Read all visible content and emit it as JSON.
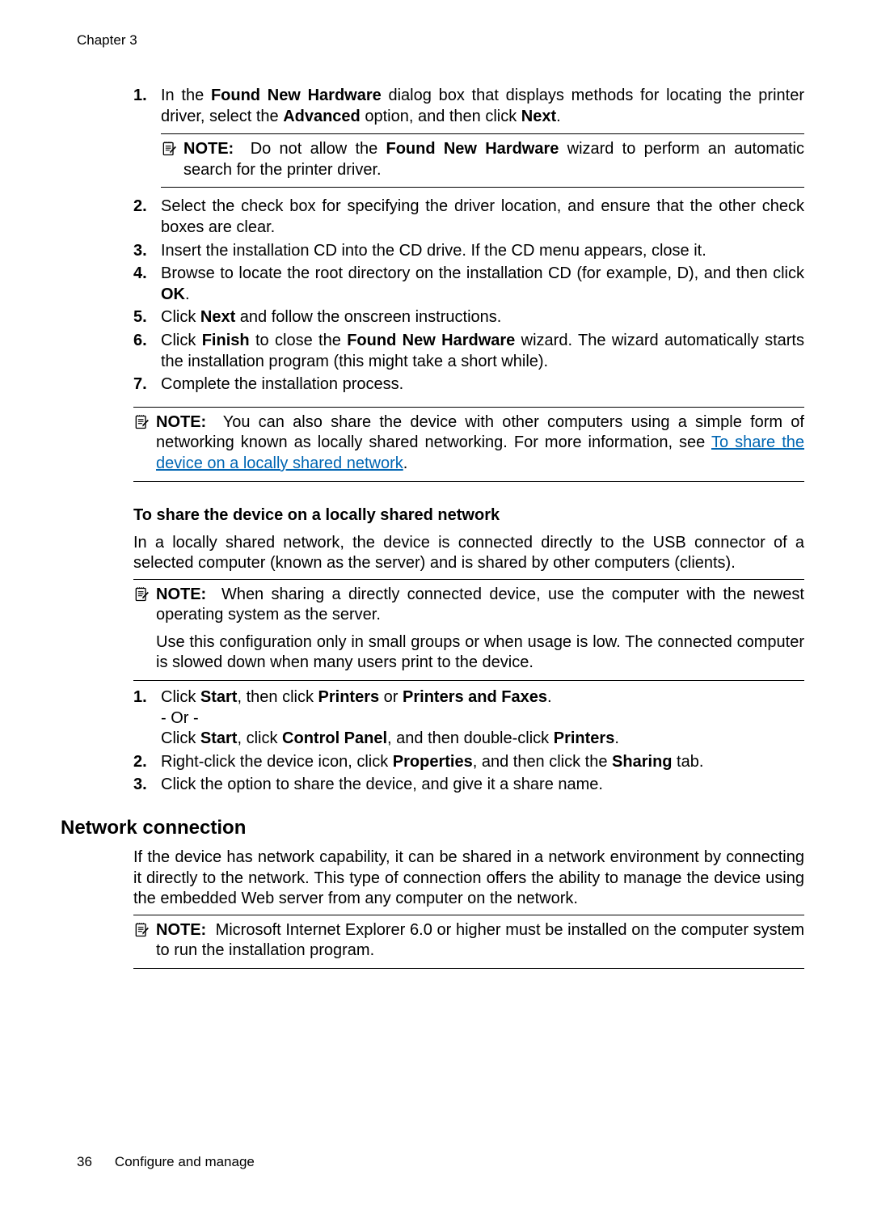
{
  "chapter": "Chapter 3",
  "list1": {
    "n1": "1.",
    "t1a": "In the ",
    "t1b": "Found New Hardware",
    "t1c": " dialog box that displays methods for locating the printer driver, select the ",
    "t1d": "Advanced",
    "t1e": " option, and then click ",
    "t1f": "Next",
    "t1g": ".",
    "note1_label": "NOTE:",
    "note1_a": "Do not allow the ",
    "note1_b": "Found New Hardware",
    "note1_c": " wizard to perform an automatic search for the printer driver.",
    "n2": "2.",
    "t2": "Select the check box for specifying the driver location, and ensure that the other check boxes are clear.",
    "n3": "3.",
    "t3": "Insert the installation CD into the CD drive. If the CD menu appears, close it.",
    "n4": "4.",
    "t4a": "Browse to locate the root directory on the installation CD (for example, D), and then click ",
    "t4b": "OK",
    "t4c": ".",
    "n5": "5.",
    "t5a": "Click ",
    "t5b": "Next",
    "t5c": " and follow the onscreen instructions.",
    "n6": "6.",
    "t6a": "Click ",
    "t6b": "Finish",
    "t6c": " to close the ",
    "t6d": "Found New Hardware",
    "t6e": " wizard. The wizard automatically starts the installation program (this might take a short while).",
    "n7": "7.",
    "t7": "Complete the installation process."
  },
  "note2": {
    "label": "NOTE:",
    "a": "You can also share the device with other computers using a simple form of networking known as locally shared networking. For more information, see ",
    "link": "To share the device on a locally shared network",
    "c": "."
  },
  "h3_share": "To share the device on a locally shared network",
  "share_para": "In a locally shared network, the device is connected directly to the USB connector of a selected computer (known as the server) and is shared by other computers (clients).",
  "note3": {
    "label": "NOTE:",
    "p1": "When sharing a directly connected device, use the computer with the newest operating system as the server.",
    "p2": "Use this configuration only in small groups or when usage is low. The connected computer is slowed down when many users print to the device."
  },
  "list2": {
    "n1": "1.",
    "t1a": "Click ",
    "t1b": "Start",
    "t1c": ", then click ",
    "t1d": "Printers",
    "t1e": " or ",
    "t1f": "Printers and Faxes",
    "t1g": ".",
    "t1or": "- Or -",
    "t1h": "Click ",
    "t1i": "Start",
    "t1j": ", click ",
    "t1k": "Control Panel",
    "t1l": ", and then double-click ",
    "t1m": "Printers",
    "t1n": ".",
    "n2": "2.",
    "t2a": "Right-click the device icon, click ",
    "t2b": "Properties",
    "t2c": ", and then click the ",
    "t2d": "Sharing",
    "t2e": " tab.",
    "n3": "3.",
    "t3": "Click the option to share the device, and give it a share name."
  },
  "h2_network": "Network connection",
  "network_para": "If the device has network capability, it can be shared in a network environment by connecting it directly to the network. This type of connection offers the ability to manage the device using the embedded Web server from any computer on the network.",
  "note4": {
    "label": "NOTE:",
    "text": "Microsoft Internet Explorer 6.0 or higher must be installed on the computer system to run the installation program."
  },
  "footer": {
    "page": "36",
    "title": "Configure and manage"
  }
}
